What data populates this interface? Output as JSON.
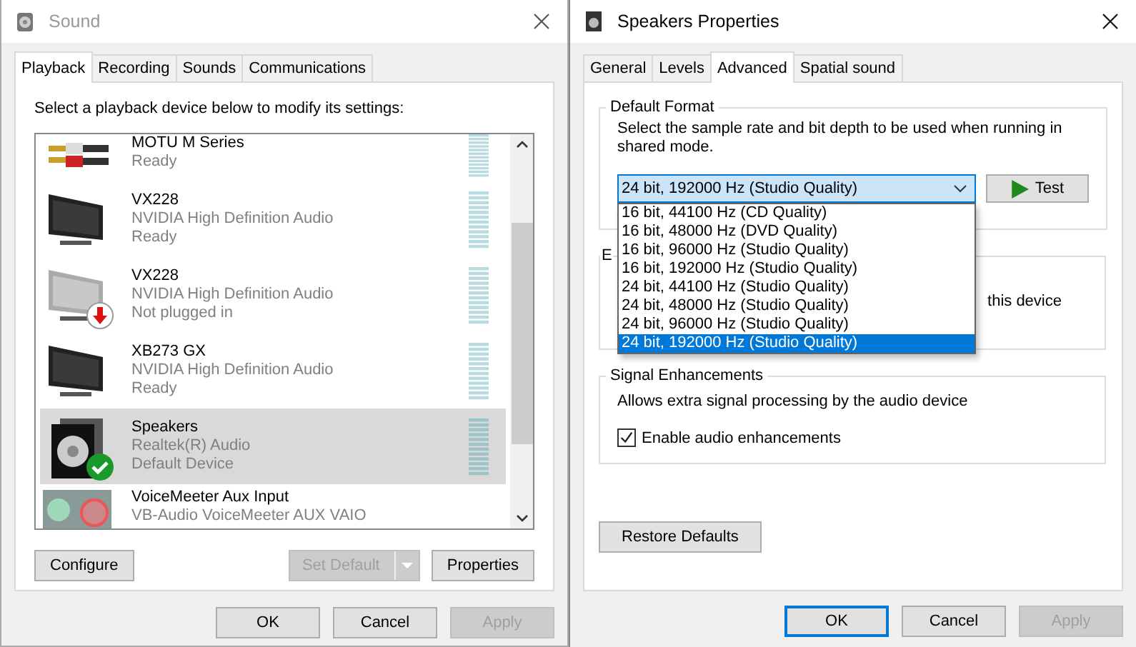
{
  "sound_window": {
    "title": "Sound",
    "active": false,
    "tabs": [
      {
        "label": "Playback",
        "selected": true
      },
      {
        "label": "Recording",
        "selected": false
      },
      {
        "label": "Sounds",
        "selected": false
      },
      {
        "label": "Communications",
        "selected": false
      }
    ],
    "instruction": "Select a playback device below to modify its settings:",
    "devices": [
      {
        "kind": "cables",
        "name": "MOTU M Series",
        "status": "Ready",
        "unplugged": false,
        "default_device": false,
        "selected": false
      },
      {
        "kind": "monitor",
        "name": "VX228",
        "driver": "NVIDIA High Definition Audio",
        "status": "Ready",
        "unplugged": false,
        "default_device": false,
        "selected": false
      },
      {
        "kind": "monitor",
        "name": "VX228",
        "driver": "NVIDIA High Definition Audio",
        "status": "Not plugged in",
        "unplugged": true,
        "default_device": false,
        "selected": false
      },
      {
        "kind": "monitor",
        "name": "XB273 GX",
        "driver": "NVIDIA High Definition Audio",
        "status": "Ready",
        "unplugged": false,
        "default_device": false,
        "selected": false
      },
      {
        "kind": "speaker",
        "name": "Speakers",
        "driver": "Realtek(R) Audio",
        "status": "Default Device",
        "unplugged": false,
        "default_device": true,
        "selected": true
      },
      {
        "kind": "mixer",
        "name": "VoiceMeeter Aux Input",
        "driver": "VB-Audio VoiceMeeter AUX VAIO",
        "unplugged": false,
        "default_device": false,
        "selected": false
      }
    ],
    "panel_buttons": [
      {
        "label": "Configure",
        "kind": "plain",
        "disabled": false
      },
      {
        "label": "Set Default",
        "kind": "split",
        "disabled": true
      },
      {
        "label": "Properties",
        "kind": "plain",
        "disabled": false
      }
    ],
    "buttons": [
      {
        "label": "OK",
        "default": false,
        "disabled": false
      },
      {
        "label": "Cancel",
        "default": false,
        "disabled": false
      },
      {
        "label": "Apply",
        "default": false,
        "disabled": true
      }
    ]
  },
  "properties_window": {
    "title": "Speakers Properties",
    "active": true,
    "tabs": [
      {
        "label": "General",
        "selected": false
      },
      {
        "label": "Levels",
        "selected": false
      },
      {
        "label": "Advanced",
        "selected": true
      },
      {
        "label": "Spatial sound",
        "selected": false
      }
    ],
    "default_format": {
      "title": "Default Format",
      "description": "Select the sample rate and bit depth to be used when running in shared mode.",
      "value": "24 bit, 192000 Hz (Studio Quality)",
      "test_button": "Test",
      "options": [
        {
          "label": "16 bit, 44100 Hz (CD Quality)",
          "selected": false
        },
        {
          "label": "16 bit, 48000 Hz (DVD Quality)",
          "selected": false
        },
        {
          "label": "16 bit, 96000 Hz (Studio Quality)",
          "selected": false
        },
        {
          "label": "16 bit, 192000 Hz (Studio Quality)",
          "selected": false
        },
        {
          "label": "24 bit, 44100 Hz (Studio Quality)",
          "selected": false
        },
        {
          "label": "24 bit, 48000 Hz (Studio Quality)",
          "selected": false
        },
        {
          "label": "24 bit, 96000 Hz (Studio Quality)",
          "selected": false
        },
        {
          "label": "24 bit, 192000 Hz (Studio Quality)",
          "selected": true
        }
      ]
    },
    "covered_group": {
      "title": "E",
      "text": "this device"
    },
    "signal_enhancements": {
      "title": "Signal Enhancements",
      "description": "Allows extra signal processing by the audio device",
      "checkbox": {
        "label": "Enable audio enhancements",
        "checked": true
      }
    },
    "restore_button": "Restore Defaults",
    "buttons": [
      {
        "label": "OK",
        "default": true,
        "disabled": false
      },
      {
        "label": "Cancel",
        "default": false,
        "disabled": false
      },
      {
        "label": "Apply",
        "default": false,
        "disabled": true
      }
    ]
  }
}
